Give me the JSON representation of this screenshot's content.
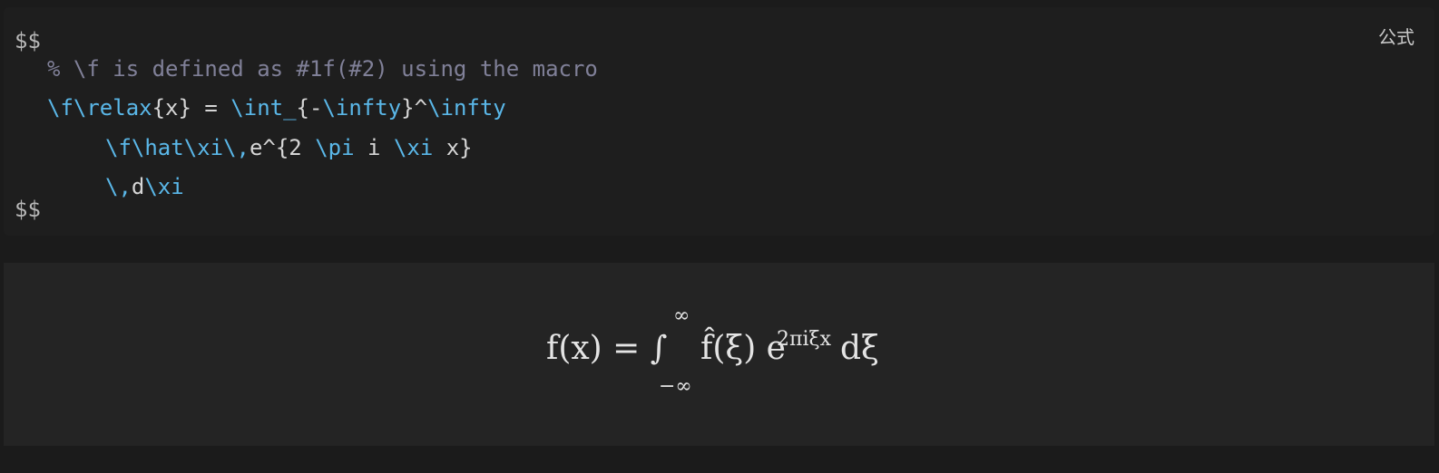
{
  "code_block": {
    "language_label": "公式",
    "open_delim": "$$",
    "close_delim": "$$",
    "comment_line": "% \\f is defined as #1f(#2) using the macro",
    "line2": {
      "cmd1": "\\f\\relax",
      "plain1": "{x} = ",
      "cmd2": "\\int_",
      "plain2": "{-",
      "cmd3": "\\infty",
      "plain3": "}^",
      "cmd4": "\\infty"
    },
    "line3": {
      "cmd1": "\\f\\hat\\xi\\,",
      "plain1": "e^{2 ",
      "cmd2": "\\pi",
      "plain2": " i ",
      "cmd3": "\\xi",
      "plain3": " x}"
    },
    "line4": {
      "cmd1": "\\,",
      "plain1": "d",
      "cmd2": "\\xi"
    }
  },
  "preview": {
    "lhs": "f(x) = ∫",
    "upper_limit": "∞",
    "lower_limit": "−∞",
    "integrand": "f̂(ξ) e",
    "exponent": "2πiξx",
    "differential": "dξ"
  },
  "colors": {
    "command": "#5ab7e8",
    "comment": "#808098",
    "code_background": "#1e1e1e",
    "preview_background": "#242424"
  }
}
